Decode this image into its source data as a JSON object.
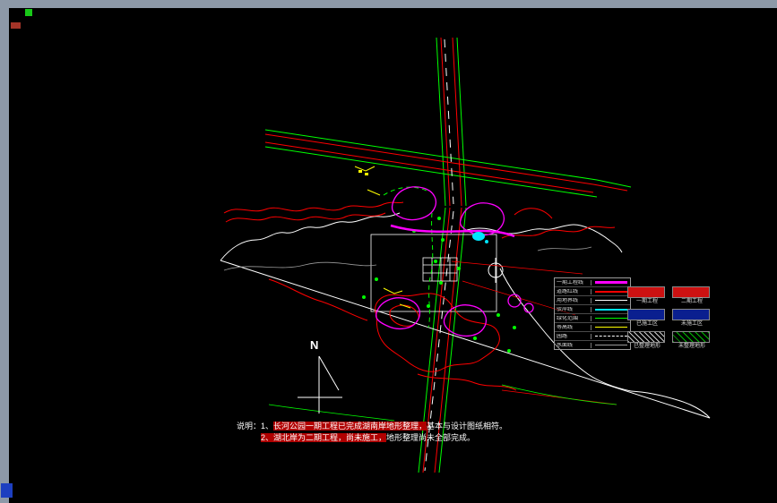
{
  "palette": {
    "frame": "#8d99a8",
    "canvas": "#000000",
    "road_red": "#ff0000",
    "veg_green": "#00ff00",
    "contour_magenta": "#ff00ff",
    "water_cyan": "#00e5ff",
    "highlight_yellow": "#ffff00",
    "boundary_white": "#ffffff"
  },
  "compass": {
    "label": "N"
  },
  "legend": {
    "rows": [
      {
        "label": "一期工程线",
        "color": "#ff00ff"
      },
      {
        "label": "道路红线",
        "color": "#ff0000"
      },
      {
        "label": "用地界线",
        "color": "#ffffff"
      },
      {
        "label": "驳岸线",
        "color": "#00e5ff"
      },
      {
        "label": "绿化范围",
        "color": "#00ff00"
      },
      {
        "label": "等高线",
        "color": "#ffff00"
      },
      {
        "label": "园路",
        "color": "#ffffff"
      },
      {
        "label": "水面线",
        "color": "#9a9a9a"
      }
    ],
    "boxes": [
      {
        "label": "一期工程",
        "fill": "#cc1111"
      },
      {
        "label": "二期工程",
        "fill": "#cc1111"
      },
      {
        "label": "已施工区",
        "fill": "#0a1f8f"
      },
      {
        "label": "未施工区",
        "fill": "#0a1f8f"
      },
      {
        "label": "已整理地形",
        "fill": "hatch-white"
      },
      {
        "label": "未整理地形",
        "fill": "hatch-green"
      }
    ]
  },
  "notes": {
    "line1": {
      "prefix": "说明：1、",
      "highlight": "长河公园一期工程已完成湖南岸地形整理，",
      "suffix": "基本与设计图纸相符。"
    },
    "line2": {
      "highlight": "2、湖北岸为二期工程，尚未施工，",
      "suffix": "地形整理尚未全部完成。"
    }
  }
}
